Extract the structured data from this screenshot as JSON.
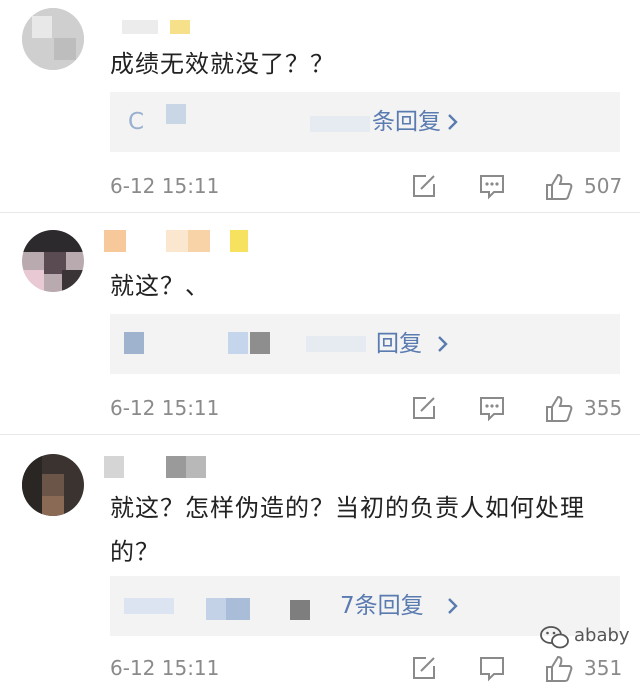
{
  "comments": [
    {
      "text": "成绩无效就没了？？",
      "reply_more": "条回复",
      "reply_prefix": "C",
      "time": "6-12 15:11",
      "likes": "507"
    },
    {
      "text": "就这？、",
      "reply_more": "回复",
      "time": "6-12 15:11",
      "likes": "355"
    },
    {
      "text": "就这？怎样伪造的？当初的负责人如何处理的？",
      "reply_more": "7条回复",
      "time": "6-12 15:11",
      "likes": "351"
    }
  ],
  "icons": [
    "edit-icon",
    "comment-icon",
    "thumbs-up-icon",
    "chevron-right-icon",
    "wechat-icon"
  ],
  "watermark": "ababy",
  "colors": {
    "link": "#5a7bb0",
    "meta": "#8a8a8a",
    "reply_bg": "#f3f3f3"
  }
}
